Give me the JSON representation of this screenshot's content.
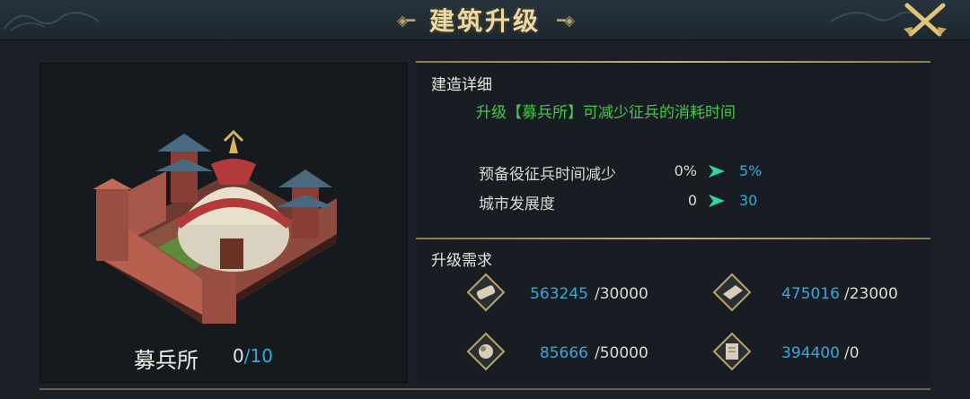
{
  "header": {
    "title": "建筑升级"
  },
  "building": {
    "name": "募兵所",
    "level_current": "0",
    "level_sep": "/",
    "level_max": "10"
  },
  "details": {
    "section_title": "建造详细",
    "description": "升级【募兵所】可减少征兵的消耗时间",
    "rows": [
      {
        "label": "预备役征兵时间减少",
        "from": "0%",
        "to": "5%"
      },
      {
        "label": "城市发展度",
        "from": "0",
        "to": "30"
      }
    ]
  },
  "requirements": {
    "section_title": "升级需求",
    "items": [
      {
        "icon": "wood-log-icon",
        "have": "563245",
        "need": "/30000"
      },
      {
        "icon": "iron-ingot-icon",
        "have": "475016",
        "need": "/23000"
      },
      {
        "icon": "stone-ore-icon",
        "have": "85666",
        "need": "/50000"
      },
      {
        "icon": "grain-scroll-icon",
        "have": "394400",
        "need": "/0"
      }
    ]
  },
  "colors": {
    "accent_gold": "#c8b07a",
    "value_blue": "#38a8d8",
    "desc_green": "#47c84a"
  }
}
